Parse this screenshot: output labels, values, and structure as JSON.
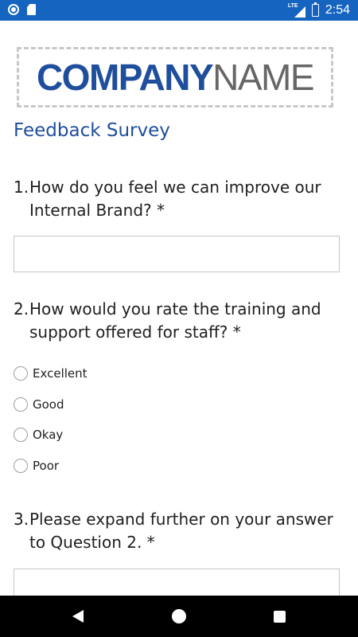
{
  "status_bar": {
    "time": "2:54",
    "network": "LTE",
    "battery_glyph": "⚡",
    "icons": [
      "circle-icon",
      "sd-card-icon",
      "lte-signal-icon",
      "battery-charging-icon"
    ],
    "background": "#1565c0"
  },
  "logo": {
    "company": "COMPANY",
    "name": "NAME",
    "company_color": "#1f4e9c",
    "name_color": "#666666"
  },
  "survey": {
    "title": "Feedback Survey",
    "title_color": "#1f4e9c",
    "questions": [
      {
        "number": "1.",
        "text": "How do you feel we can improve our Internal Brand? *",
        "type": "text",
        "value": ""
      },
      {
        "number": "2.",
        "text": "How would you rate the training and support offered for staff? *",
        "type": "radio",
        "options": [
          "Excellent",
          "Good",
          "Okay",
          "Poor"
        ],
        "selected": null
      },
      {
        "number": "3.",
        "text": "Please expand further on your answer to Question 2. *",
        "type": "text",
        "value": ""
      }
    ]
  },
  "nav_bar": {
    "icons": [
      "back-icon",
      "home-icon",
      "recents-icon"
    ]
  }
}
